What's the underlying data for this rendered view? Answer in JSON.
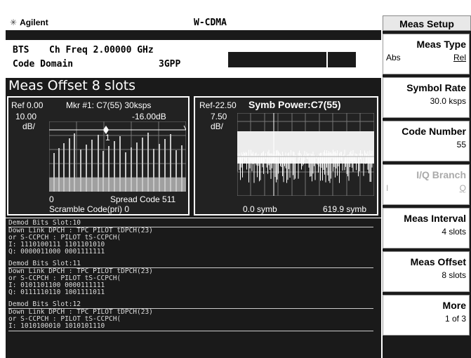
{
  "header": {
    "brand": "Agilent",
    "mode": "W-CDMA",
    "menu_title": "Meas Setup"
  },
  "info": {
    "line1_label": "BTS",
    "line1_value": "Ch Freq 2.00000 GHz",
    "line2_label": "Code Domain",
    "line2_value": "3GPP"
  },
  "offset_title": "Meas Offset 8 slots",
  "left_panel": {
    "ref": "Ref 0.00",
    "marker": "Mkr #1: C7(55) 30ksps",
    "scale": "10.00",
    "unit": "dB/",
    "marker_level": "-16.00dB",
    "marker_num": "1",
    "x_start": "0",
    "x_label": "Spread Code  511",
    "scramble": "Scramble Code(pri) 0"
  },
  "right_panel": {
    "ref": "Ref-22.50",
    "title": "Symb Power:C7(55)",
    "scale": "7.50",
    "unit": "dB/",
    "x_start": "0.0 symb",
    "x_end": "619.9 symb"
  },
  "demod": [
    {
      "header": "Demod Bits  Slot:10",
      "line1": "Down Link DPCH : TPC   PILOT tDPCH(23)",
      "line2": "   or  S-CCPCH :       PILOT tS-CCPCH(",
      "i_bits": "I: 1110100111 1101101010",
      "q_bits": "Q: 0000011000 0001111111"
    },
    {
      "header": "Demod Bits  Slot:11",
      "line1": "Down Link DPCH : TPC   PILOT tDPCH(23)",
      "line2": "   or  S-CCPCH :       PILOT tS-CCPCH(",
      "i_bits": "I: 0101101100 0000111111",
      "q_bits": "Q: 0111110110 1001111011"
    },
    {
      "header": "Demod Bits  Slot:12",
      "line1": "Down Link DPCH : TPC   PILOT tDPCH(23)",
      "line2": "   or  S-CCPCH :       PILOT tS-CCPCH(",
      "i_bits": "I: 1010100010 1010101110",
      "q_bits": ""
    }
  ],
  "softkeys": [
    {
      "main": "Meas Type",
      "sub_left": "Abs",
      "sub": "Rel",
      "enabled": true
    },
    {
      "main": "Symbol Rate",
      "sub_left": "",
      "sub": "30.0 ksps",
      "enabled": true
    },
    {
      "main": "Code Number",
      "sub_left": "",
      "sub": "55",
      "enabled": true
    },
    {
      "main": "I/Q Branch",
      "sub_left": "I",
      "sub": "Q",
      "enabled": false
    },
    {
      "main": "Meas Interval",
      "sub_left": "",
      "sub": "4 slots",
      "enabled": true
    },
    {
      "main": "Meas Offset",
      "sub_left": "",
      "sub": "8 slots",
      "enabled": true
    },
    {
      "main": "More",
      "sub_left": "",
      "sub": "1 of 3",
      "enabled": true
    }
  ],
  "colors": {
    "screen_bg": "#1a1a1a",
    "trace": "#ffffff",
    "bar_fill": "#a0a0a0"
  }
}
